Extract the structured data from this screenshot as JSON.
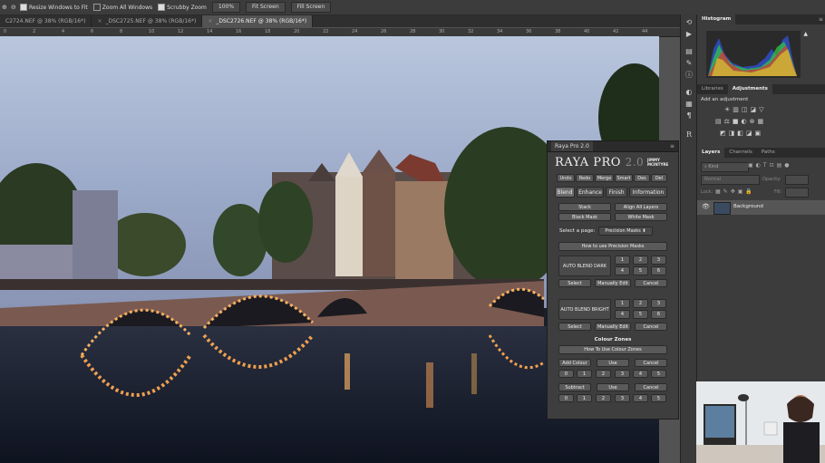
{
  "options_bar": {
    "resize_windows": "Resize Windows to Fit",
    "zoom_all": "Zoom All Windows",
    "scrubby_zoom": "Scrubby Zoom",
    "zoom_value": "100%",
    "fit_screen": "Fit Screen",
    "fill_screen": "Fill Screen"
  },
  "tabs": [
    {
      "label": "C2724.NEF @ 38% (RGB/16*)"
    },
    {
      "label": "_DSC2725.NEF @ 38% (RGB/16*)"
    },
    {
      "label": "_DSC2726.NEF @ 38% (RGB/16*)"
    }
  ],
  "ruler": [
    "0",
    "2",
    "4",
    "6",
    "8",
    "10",
    "12",
    "14",
    "16",
    "18",
    "20",
    "22",
    "24",
    "26",
    "28",
    "30",
    "32",
    "34",
    "36",
    "38",
    "40",
    "42",
    "44"
  ],
  "raya": {
    "panel_title": "Raya Pro 2.0",
    "logo": "RAYA PRO",
    "logo_version": "2.0",
    "logo_author_1": "JIMMY",
    "logo_author_2": "MCINTYRE",
    "top_buttons": [
      "Undo",
      "Redo",
      "Merge",
      "Smart",
      "Des",
      "Del"
    ],
    "tabs": [
      "Blend",
      "Enhance",
      "Finish",
      "Information"
    ],
    "stack": "Stack",
    "align_all_layers": "Align All Layers",
    "black_mask": "Black Mask",
    "white_mask": "White Mask",
    "select_page_label": "Select a page:",
    "select_page_value": "Precision Masks",
    "how_precision": "How to use Precision Masks",
    "auto_blend_dark": "AUTO BLEND DARK",
    "auto_blend_bright": "AUTO BLEND BRIGHT",
    "nums": [
      "1",
      "2",
      "3",
      "4",
      "5",
      "6"
    ],
    "select": "Select",
    "manually_edit": "Manually Edit",
    "cancel": "Cancel",
    "colour_zones": "Colour Zones",
    "how_colour": "How To Use Colour Zones",
    "add_colour": "Add Colour",
    "use": "Use",
    "subtract": "Subtract",
    "zones": [
      "0",
      "1",
      "2",
      "3",
      "4",
      "5"
    ]
  },
  "panels": {
    "histogram_tab": "Histogram",
    "libraries_tab": "Libraries",
    "adjustments_tab": "Adjustments",
    "add_adjustment": "Add an adjustment",
    "layers_tab": "Layers",
    "channels_tab": "Channels",
    "paths_tab": "Paths",
    "kind": "Kind",
    "blend_mode": "Normal",
    "opacity_label": "Opacity:",
    "lock_label": "Lock:",
    "fill_label": "Fill:",
    "layer_name": "Background"
  },
  "colors": {
    "accent": "#4a4a4a",
    "panel_bg": "#3e3e3e"
  }
}
